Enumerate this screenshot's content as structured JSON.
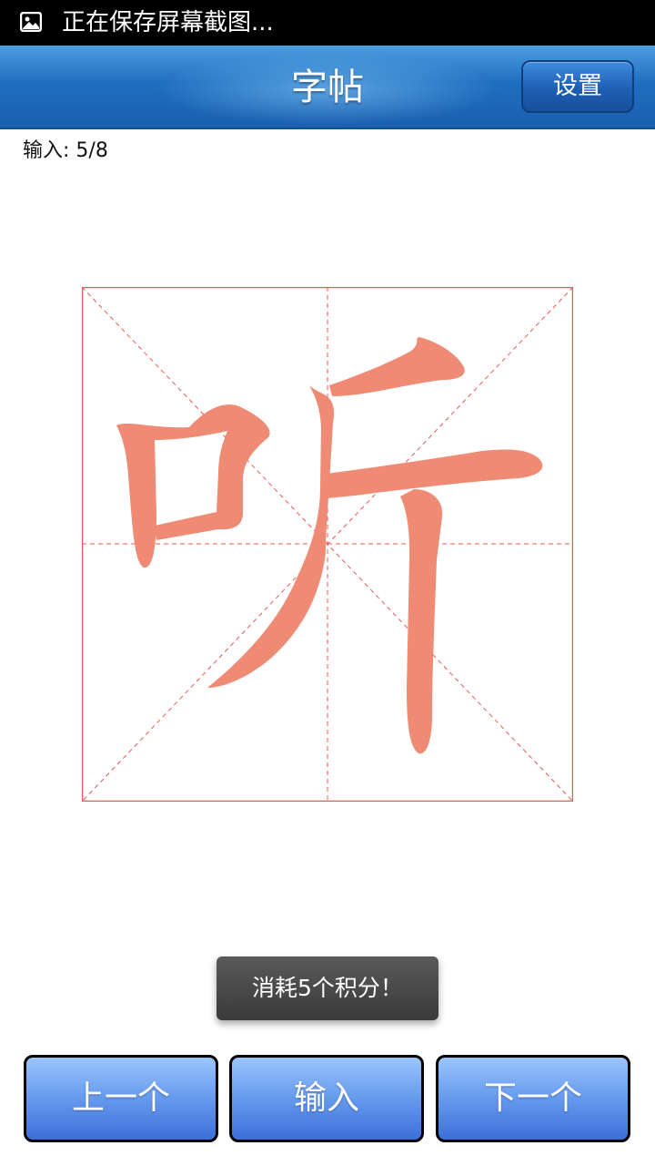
{
  "status_bar": {
    "notification_icon": "image-icon",
    "text": "正在保存屏幕截图..."
  },
  "header": {
    "title": "字帖",
    "settings_label": "设置"
  },
  "main": {
    "input_counter": "输入: 5/8",
    "character": "听",
    "character_color": "#ef8b74",
    "grid_color": "#e85a5a"
  },
  "toast": {
    "text": "消耗5个积分！"
  },
  "footer": {
    "prev_label": "上一个",
    "input_label": "输入",
    "next_label": "下一个"
  }
}
